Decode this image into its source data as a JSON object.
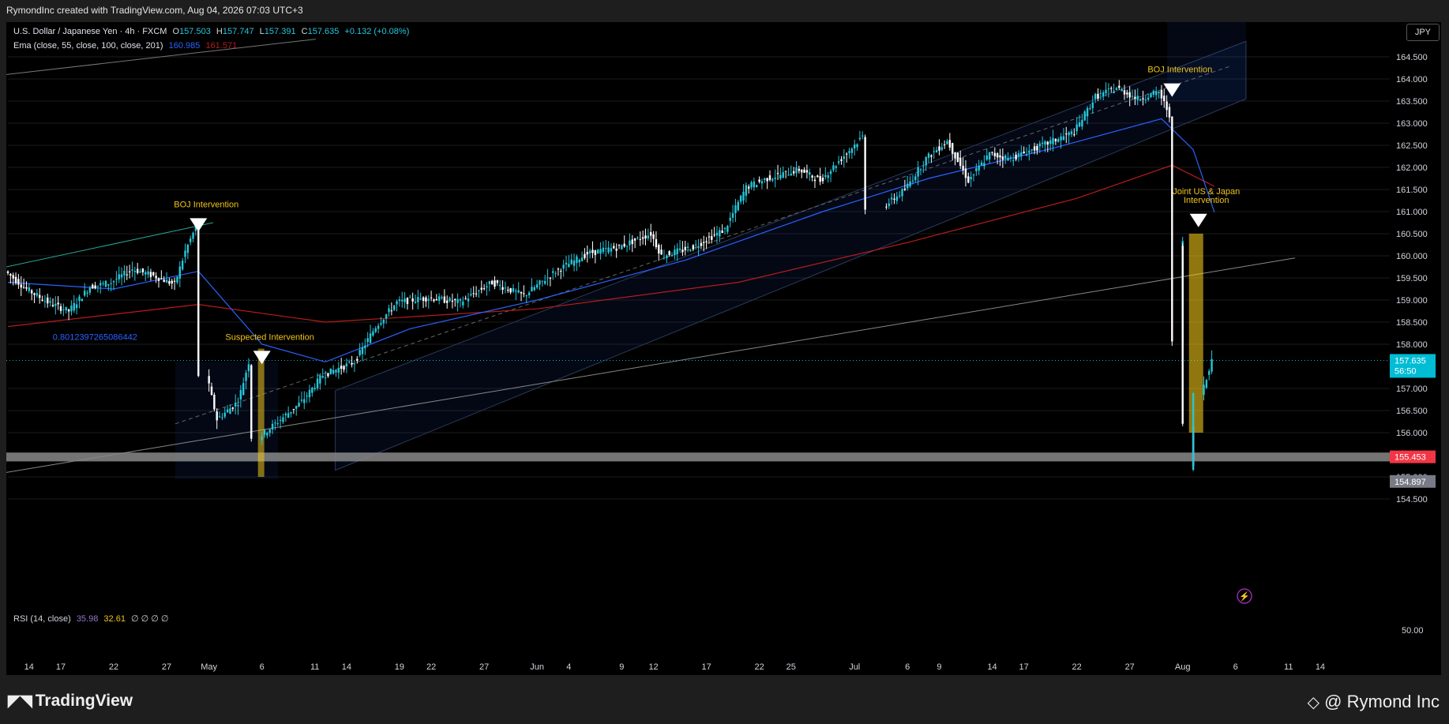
{
  "header": {
    "text": "RymondInc created with TradingView.com, Aug 04, 2026 07:03 UTC+3"
  },
  "legend": {
    "symbol": "U.S. Dollar / Japanese Yen · 4h · FXCM",
    "o_label": "O",
    "o": "157.503",
    "h_label": "H",
    "h": "157.747",
    "l_label": "L",
    "l": "157.391",
    "c_label": "C",
    "c": "157.635",
    "change": "+0.132 (+0.08%)",
    "ema_label": "Ema (close, 55, close, 100, close, 201)",
    "ema1": "160.985",
    "ema2": "161.571",
    "rsi_label": "RSI (14, close)",
    "rsi1": "35.98",
    "rsi2": "32.61",
    "rsi_rest": "∅ ∅ ∅ ∅"
  },
  "currency_button": "JPY",
  "colors": {
    "accent": "#00bcd4",
    "bear": "#f05350",
    "bull": "#4caf50",
    "ema55": "#2962ff",
    "ema201": "#b71c1c",
    "annotation": "#f0c419"
  },
  "chart_data": {
    "type": "candlestick",
    "symbol": "USDJPY",
    "timeframe": "4h",
    "ylim": [
      154.25,
      164.75
    ],
    "y_ticks": [
      "164.500",
      "164.000",
      "163.500",
      "163.000",
      "162.500",
      "162.000",
      "161.500",
      "161.000",
      "160.500",
      "160.000",
      "159.500",
      "159.000",
      "158.500",
      "158.000",
      "157.000",
      "156.500",
      "156.000",
      "155.000",
      "154.500"
    ],
    "rsi_tick": "50.00",
    "x_ticks": [
      "14",
      "17",
      "22",
      "27",
      "May",
      "6",
      "11",
      "14",
      "19",
      "22",
      "27",
      "Jun",
      "4",
      "9",
      "12",
      "17",
      "22",
      "25",
      "Jul",
      "6",
      "9",
      "14",
      "17",
      "22",
      "27",
      "Aug",
      "6",
      "11",
      "14"
    ],
    "x_domain": [
      "2026-04-12",
      "2026-08-16"
    ],
    "x_tick_dates": [
      "2026-04-14",
      "2026-04-17",
      "2026-04-22",
      "2026-04-27",
      "2026-05-01",
      "2026-05-06",
      "2026-05-11",
      "2026-05-14",
      "2026-05-19",
      "2026-05-22",
      "2026-05-27",
      "2026-06-01",
      "2026-06-04",
      "2026-06-09",
      "2026-06-12",
      "2026-06-17",
      "2026-06-22",
      "2026-06-25",
      "2026-07-01",
      "2026-07-06",
      "2026-07-09",
      "2026-07-14",
      "2026-07-17",
      "2026-07-22",
      "2026-07-27",
      "2026-08-01",
      "2026-08-06",
      "2026-08-11",
      "2026-08-14"
    ],
    "close_path": [
      {
        "date": "2026-04-12",
        "price": 159.65
      },
      {
        "date": "2026-04-14",
        "price": 159.25
      },
      {
        "date": "2026-04-16",
        "price": 158.95
      },
      {
        "date": "2026-04-18",
        "price": 158.75
      },
      {
        "date": "2026-04-20",
        "price": 159.3
      },
      {
        "date": "2026-04-22",
        "price": 159.4
      },
      {
        "date": "2026-04-24",
        "price": 159.7
      },
      {
        "date": "2026-04-26",
        "price": 159.55
      },
      {
        "date": "2026-04-28",
        "price": 159.35
      },
      {
        "date": "2026-04-29",
        "price": 160.1
      },
      {
        "date": "2026-04-30",
        "price": 160.65
      },
      {
        "date": "2026-05-01",
        "price": 157.3
      },
      {
        "date": "2026-05-02",
        "price": 156.3
      },
      {
        "date": "2026-05-04",
        "price": 156.7
      },
      {
        "date": "2026-05-05",
        "price": 157.6
      },
      {
        "date": "2026-05-06",
        "price": 155.9
      },
      {
        "date": "2026-05-08",
        "price": 156.3
      },
      {
        "date": "2026-05-10",
        "price": 156.7
      },
      {
        "date": "2026-05-12",
        "price": 157.3
      },
      {
        "date": "2026-05-15",
        "price": 157.6
      },
      {
        "date": "2026-05-17",
        "price": 158.4
      },
      {
        "date": "2026-05-19",
        "price": 158.95
      },
      {
        "date": "2026-05-22",
        "price": 159.05
      },
      {
        "date": "2026-05-25",
        "price": 158.95
      },
      {
        "date": "2026-05-28",
        "price": 159.4
      },
      {
        "date": "2026-05-31",
        "price": 159.1
      },
      {
        "date": "2026-06-03",
        "price": 159.65
      },
      {
        "date": "2026-06-06",
        "price": 160.05
      },
      {
        "date": "2026-06-09",
        "price": 160.2
      },
      {
        "date": "2026-06-12",
        "price": 160.5
      },
      {
        "date": "2026-06-13",
        "price": 160.0
      },
      {
        "date": "2026-06-16",
        "price": 160.2
      },
      {
        "date": "2026-06-19",
        "price": 160.6
      },
      {
        "date": "2026-06-21",
        "price": 161.55
      },
      {
        "date": "2026-06-23",
        "price": 161.75
      },
      {
        "date": "2026-06-26",
        "price": 161.95
      },
      {
        "date": "2026-06-28",
        "price": 161.7
      },
      {
        "date": "2026-06-30",
        "price": 162.2
      },
      {
        "date": "2026-07-02",
        "price": 162.7
      },
      {
        "date": "2026-07-04",
        "price": 161.1
      },
      {
        "date": "2026-07-06",
        "price": 161.5
      },
      {
        "date": "2026-07-08",
        "price": 162.2
      },
      {
        "date": "2026-07-10",
        "price": 162.6
      },
      {
        "date": "2026-07-12",
        "price": 161.7
      },
      {
        "date": "2026-07-14",
        "price": 162.3
      },
      {
        "date": "2026-07-16",
        "price": 162.2
      },
      {
        "date": "2026-07-19",
        "price": 162.5
      },
      {
        "date": "2026-07-22",
        "price": 162.8
      },
      {
        "date": "2026-07-24",
        "price": 163.6
      },
      {
        "date": "2026-07-26",
        "price": 163.8
      },
      {
        "date": "2026-07-28",
        "price": 163.55
      },
      {
        "date": "2026-07-30",
        "price": 163.7
      },
      {
        "date": "2026-07-31",
        "price": 163.2
      },
      {
        "date": "2026-08-01",
        "price": 158.0
      },
      {
        "date": "2026-08-01",
        "price": 160.3
      },
      {
        "date": "2026-08-02",
        "price": 156.2
      },
      {
        "date": "2026-08-02",
        "price": 155.2
      },
      {
        "date": "2026-08-03",
        "price": 156.9
      },
      {
        "date": "2026-08-04",
        "price": 157.635
      }
    ],
    "ema55": [
      {
        "date": "2026-04-12",
        "price": 159.4
      },
      {
        "date": "2026-04-22",
        "price": 159.25
      },
      {
        "date": "2026-04-30",
        "price": 159.65
      },
      {
        "date": "2026-05-06",
        "price": 158.0
      },
      {
        "date": "2026-05-12",
        "price": 157.6
      },
      {
        "date": "2026-05-20",
        "price": 158.35
      },
      {
        "date": "2026-06-01",
        "price": 159.0
      },
      {
        "date": "2026-06-15",
        "price": 159.9
      },
      {
        "date": "2026-06-28",
        "price": 161.0
      },
      {
        "date": "2026-07-08",
        "price": 161.75
      },
      {
        "date": "2026-07-20",
        "price": 162.45
      },
      {
        "date": "2026-07-30",
        "price": 163.1
      },
      {
        "date": "2026-08-02",
        "price": 162.4
      },
      {
        "date": "2026-08-04",
        "price": 160.985
      }
    ],
    "ema201": [
      {
        "date": "2026-04-12",
        "price": 158.4
      },
      {
        "date": "2026-04-30",
        "price": 158.9
      },
      {
        "date": "2026-05-12",
        "price": 158.5
      },
      {
        "date": "2026-06-01",
        "price": 158.8
      },
      {
        "date": "2026-06-20",
        "price": 159.4
      },
      {
        "date": "2026-07-06",
        "price": 160.3
      },
      {
        "date": "2026-07-22",
        "price": 161.3
      },
      {
        "date": "2026-07-31",
        "price": 162.05
      },
      {
        "date": "2026-08-04",
        "price": 161.571
      }
    ],
    "price_labels": [
      {
        "price": 157.635,
        "text": "157.635",
        "sub": "56:50",
        "color": "#00bcd4"
      },
      {
        "price": 155.453,
        "text": "155.453",
        "color": "#f23645"
      },
      {
        "price": 154.897,
        "text": "154.897",
        "color": "#787b86"
      }
    ],
    "support_band": [
      155.35,
      155.55
    ],
    "annotations": [
      {
        "date": "2026-04-30",
        "price": 160.85,
        "text": "BOJ Intervention"
      },
      {
        "date": "2026-05-06",
        "price": 157.85,
        "text": "Suspected Intervention"
      },
      {
        "date": "2026-07-31",
        "price": 163.9,
        "text": "BOJ Intervention"
      },
      {
        "date": "2026-08-01",
        "price": 160.95,
        "text": "Joint US & Japan Intervention"
      }
    ],
    "fib_label": {
      "date": "2026-04-14",
      "price": 158.1,
      "text": "0.8012397265086442"
    },
    "rsi_signals": [
      {
        "date": "2026-05-20",
        "type": "Bear"
      },
      {
        "date": "2026-05-22",
        "type": "Bear"
      },
      {
        "date": "2026-06-03",
        "type": "Bear"
      },
      {
        "date": "2026-06-09",
        "type": "Bear"
      },
      {
        "date": "2026-06-22",
        "type": "Bear"
      },
      {
        "date": "2026-06-26",
        "type": "Bear"
      },
      {
        "date": "2026-07-27",
        "type": "Bear"
      },
      {
        "date": "2026-05-06",
        "type": "Bull"
      },
      {
        "date": "2026-05-31",
        "type": "Bull"
      },
      {
        "date": "2026-08-02",
        "type": "Bull"
      }
    ]
  },
  "footer": {
    "logo": "TradingView",
    "author": "@ Rymond Inc"
  }
}
